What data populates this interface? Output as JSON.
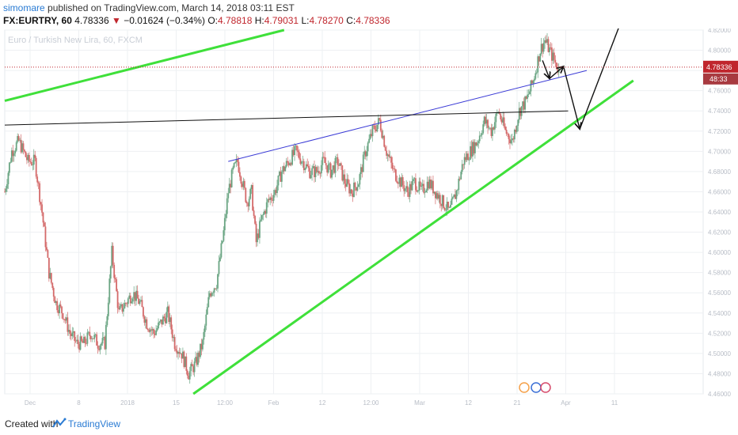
{
  "header": {
    "user": "simomare",
    "published_text": "published on TradingView.com, March 14, 2018 03:11 EST",
    "symbol": "FX:EURTRY, 60",
    "last": "4.78336",
    "change_arrow": "▼",
    "change": "−0.01624 (−0.34%)",
    "o_label": "O:",
    "o": "4.78818",
    "h_label": "H:",
    "h": "4.79031",
    "l_label": "L:",
    "l": "4.78270",
    "c_label": "C:",
    "c": "4.78336"
  },
  "footer": {
    "created": "Created with",
    "brand": "TradingView"
  },
  "colors": {
    "up": "#6aa583",
    "down": "#d46a6a",
    "green_line": "#3fe03a",
    "blue_line": "#3b3bd6",
    "black_line": "#111111",
    "price_badge": "#c0262d"
  },
  "chart_data": {
    "type": "candlestick",
    "title": "Euro / Turkish New Lira, 60, FXCM",
    "ylim": [
      4.46,
      4.82
    ],
    "y_ticks": [
      "4.82000",
      "4.80000",
      "4.78000",
      "4.76000",
      "4.74000",
      "4.72000",
      "4.70000",
      "4.68000",
      "4.66000",
      "4.64000",
      "4.62000",
      "4.60000",
      "4.58000",
      "4.56000",
      "4.54000",
      "4.52000",
      "4.50000",
      "4.48000",
      "4.46000"
    ],
    "x_ticks": [
      "Dec",
      "8",
      "2018",
      "15",
      "12:00",
      "Feb",
      "12",
      "12:00",
      "Mar",
      "12",
      "21",
      "Apr",
      "11"
    ],
    "last_price": "4.78336",
    "countdown": "48:33",
    "price_path": [
      [
        0,
        4.66
      ],
      [
        3,
        4.7
      ],
      [
        6,
        4.71
      ],
      [
        10,
        4.69
      ],
      [
        13,
        4.69
      ],
      [
        16,
        4.64
      ],
      [
        19,
        4.58
      ],
      [
        22,
        4.55
      ],
      [
        25,
        4.54
      ],
      [
        28,
        4.52
      ],
      [
        31,
        4.51
      ],
      [
        34,
        4.51
      ],
      [
        37,
        4.52
      ],
      [
        40,
        4.51
      ],
      [
        43,
        4.51
      ],
      [
        46,
        4.6
      ],
      [
        49,
        4.54
      ],
      [
        52,
        4.55
      ],
      [
        55,
        4.56
      ],
      [
        58,
        4.55
      ],
      [
        61,
        4.53
      ],
      [
        64,
        4.52
      ],
      [
        67,
        4.53
      ],
      [
        70,
        4.54
      ],
      [
        73,
        4.51
      ],
      [
        76,
        4.5
      ],
      [
        79,
        4.48
      ],
      [
        82,
        4.49
      ],
      [
        85,
        4.51
      ],
      [
        88,
        4.56
      ],
      [
        91,
        4.57
      ],
      [
        94,
        4.62
      ],
      [
        96,
        4.66
      ],
      [
        98,
        4.68
      ],
      [
        100,
        4.69
      ],
      [
        102,
        4.67
      ],
      [
        104,
        4.65
      ],
      [
        106,
        4.66
      ],
      [
        108,
        4.61
      ],
      [
        110,
        4.63
      ],
      [
        113,
        4.65
      ],
      [
        116,
        4.66
      ],
      [
        119,
        4.68
      ],
      [
        122,
        4.69
      ],
      [
        125,
        4.7
      ],
      [
        128,
        4.69
      ],
      [
        131,
        4.68
      ],
      [
        134,
        4.68
      ],
      [
        137,
        4.69
      ],
      [
        140,
        4.68
      ],
      [
        143,
        4.69
      ],
      [
        146,
        4.67
      ],
      [
        149,
        4.66
      ],
      [
        152,
        4.67
      ],
      [
        155,
        4.7
      ],
      [
        158,
        4.72
      ],
      [
        161,
        4.73
      ],
      [
        164,
        4.7
      ],
      [
        167,
        4.68
      ],
      [
        170,
        4.67
      ],
      [
        173,
        4.66
      ],
      [
        176,
        4.67
      ],
      [
        179,
        4.66
      ],
      [
        182,
        4.67
      ],
      [
        185,
        4.66
      ],
      [
        188,
        4.65
      ],
      [
        191,
        4.64
      ],
      [
        194,
        4.66
      ],
      [
        197,
        4.69
      ],
      [
        200,
        4.7
      ],
      [
        203,
        4.71
      ],
      [
        206,
        4.73
      ],
      [
        209,
        4.72
      ],
      [
        212,
        4.74
      ],
      [
        215,
        4.72
      ],
      [
        218,
        4.71
      ],
      [
        221,
        4.74
      ],
      [
        224,
        4.75
      ],
      [
        227,
        4.77
      ],
      [
        230,
        4.8
      ],
      [
        232,
        4.81
      ],
      [
        234,
        4.8
      ],
      [
        236,
        4.79
      ],
      [
        238,
        4.78
      ]
    ],
    "annotations": [
      {
        "type": "trendline",
        "color": "green",
        "from": [
          0,
          4.75
        ],
        "to": [
          120,
          4.82
        ]
      },
      {
        "type": "trendline",
        "color": "green",
        "from": [
          81,
          4.46
        ],
        "to": [
          270,
          4.77
        ]
      },
      {
        "type": "trendline",
        "color": "blue",
        "from": [
          96,
          4.69
        ],
        "to": [
          250,
          4.78
        ]
      },
      {
        "type": "trendline",
        "color": "black",
        "from": [
          0,
          4.726
        ],
        "to": [
          242,
          4.74
        ]
      },
      {
        "type": "arrow",
        "from": [
          231,
          4.79
        ],
        "to": [
          234,
          4.772
        ]
      },
      {
        "type": "arrow",
        "from": [
          234,
          4.772
        ],
        "to": [
          240,
          4.784
        ]
      },
      {
        "type": "arrow",
        "from": [
          240,
          4.784
        ],
        "to": [
          247,
          4.722
        ]
      },
      {
        "type": "line",
        "from": [
          247,
          4.722
        ],
        "to": [
          265,
          4.83
        ]
      }
    ]
  }
}
